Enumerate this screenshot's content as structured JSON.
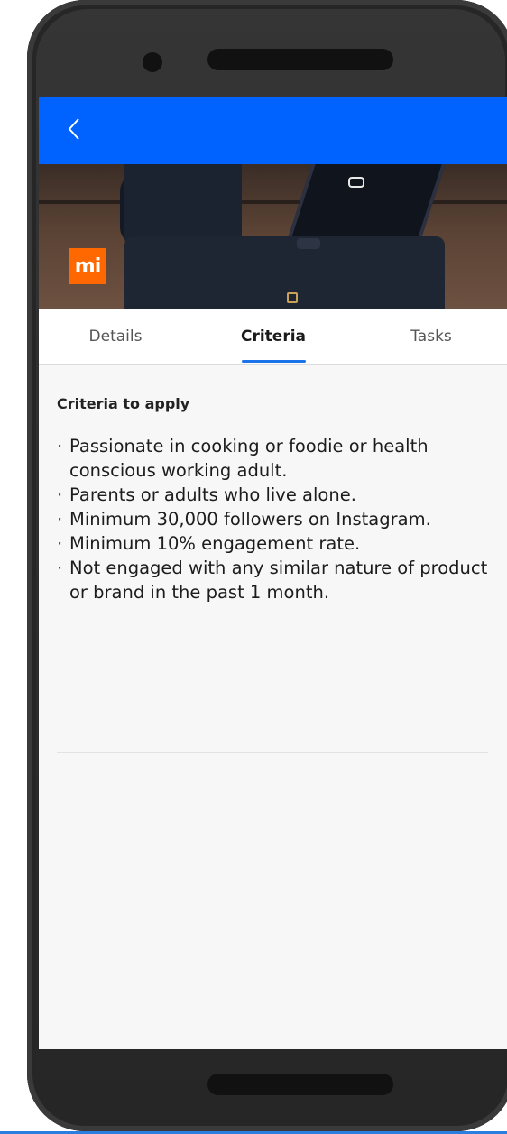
{
  "header": {
    "back_icon": "chevron-left-icon",
    "accent_color": "#0062ff"
  },
  "hero": {
    "logo_text": "mi",
    "logo_color": "#ff6700"
  },
  "tabs": [
    {
      "label": "Details",
      "active": false
    },
    {
      "label": "Criteria",
      "active": true
    },
    {
      "label": "Tasks",
      "active": false
    }
  ],
  "criteria": {
    "heading": "Criteria to apply",
    "items": [
      "Passionate in cooking or foodie or health conscious working adult.",
      "Parents or adults who live alone.",
      "Minimum 30,000 followers on Instagram.",
      "Minimum 10% engagement rate.",
      "Not engaged with any similar nature of product or brand in the past 1 month."
    ]
  }
}
